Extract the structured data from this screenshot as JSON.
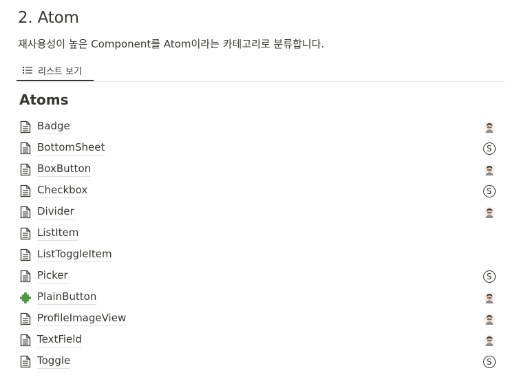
{
  "page": {
    "title": "2. Atom",
    "description": "재사용성이 높은 Component를 Atom이라는 카테고리로 분류합니다."
  },
  "view_tab": {
    "label": "리스트 보기",
    "icon": "list-icon"
  },
  "group": {
    "title": "Atoms"
  },
  "items": [
    {
      "name": "Badge",
      "icon": "page-icon",
      "assignee": "avatar"
    },
    {
      "name": "BottomSheet",
      "icon": "page-icon",
      "assignee": "S"
    },
    {
      "name": "BoxButton",
      "icon": "page-icon",
      "assignee": "avatar"
    },
    {
      "name": "Checkbox",
      "icon": "page-icon",
      "assignee": "S"
    },
    {
      "name": "Divider",
      "icon": "page-icon",
      "assignee": "avatar"
    },
    {
      "name": "ListItem",
      "icon": "page-icon",
      "assignee": ""
    },
    {
      "name": "ListToggleItem",
      "icon": "page-icon",
      "assignee": ""
    },
    {
      "name": "Picker",
      "icon": "page-icon",
      "assignee": "S"
    },
    {
      "name": "PlainButton",
      "icon": "puzzle-icon",
      "assignee": "avatar"
    },
    {
      "name": "ProfileImageView",
      "icon": "page-icon",
      "assignee": "avatar"
    },
    {
      "name": "TextField",
      "icon": "page-icon",
      "assignee": "avatar"
    },
    {
      "name": "Toggle",
      "icon": "page-icon",
      "assignee": "S"
    }
  ],
  "colors": {
    "text": "#37352f",
    "divider": "#e9e9e7",
    "puzzle": "#4f9a3f"
  }
}
